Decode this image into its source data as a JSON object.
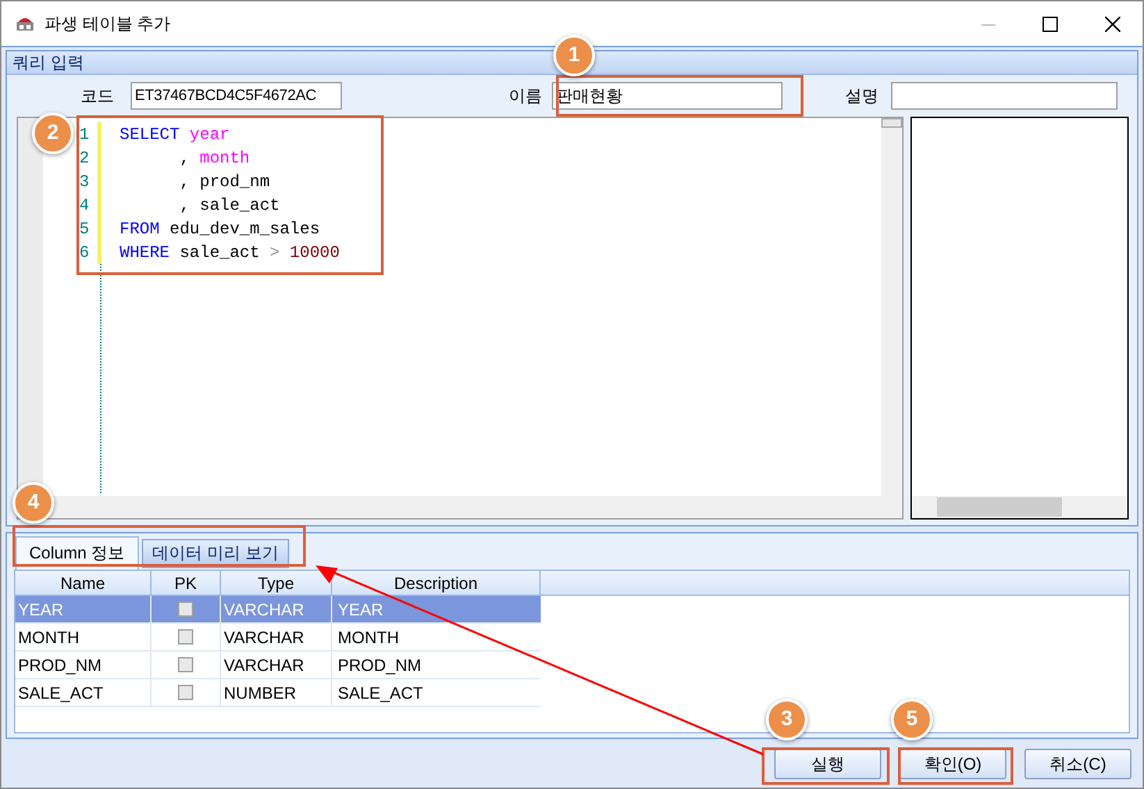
{
  "window": {
    "title": "파생 테이블 추가"
  },
  "group": {
    "title": "쿼리 입력"
  },
  "fields": [
    {
      "label": "코드",
      "value": "ET37467BCD4C5F4672AC"
    },
    {
      "label": "이름",
      "value": "판매현황"
    },
    {
      "label": "설명"
    }
  ],
  "editor": {
    "lines": [
      {
        "number": "1",
        "tokens": [
          {
            "kind": "keyword",
            "text": "SELECT"
          },
          {
            "kind": "column",
            "text": "year"
          }
        ]
      },
      {
        "number": "2",
        "tokens": [
          {
            "kind": "plain",
            "text": "      ,"
          },
          {
            "kind": "column",
            "text": "month"
          }
        ]
      },
      {
        "number": "3",
        "tokens": [
          {
            "kind": "plain",
            "text": "      ,"
          },
          {
            "kind": "plain",
            "text": "prod_nm"
          }
        ]
      },
      {
        "number": "4",
        "tokens": [
          {
            "kind": "plain",
            "text": "      ,"
          },
          {
            "kind": "plain",
            "text": "sale_act"
          }
        ]
      },
      {
        "number": "5",
        "tokens": [
          {
            "kind": "keyword",
            "text": "FROM"
          },
          {
            "kind": "plain",
            "text": "edu_dev_m_sales"
          }
        ]
      },
      {
        "number": "6",
        "tokens": [
          {
            "kind": "keyword",
            "text": "WHERE"
          },
          {
            "kind": "plain",
            "text": "sale_act"
          },
          {
            "kind": "operator",
            "text": ">"
          },
          {
            "kind": "number",
            "text": "10000"
          }
        ]
      }
    ]
  },
  "tabs": [
    {
      "label": "Column 정보",
      "selected": true
    },
    {
      "label": "데이터 미리 보기",
      "selected": false
    }
  ],
  "table": {
    "columns": [
      "Name",
      "PK",
      "Type",
      "Description"
    ],
    "rows": [
      {
        "name": "YEAR",
        "pk": false,
        "type": "VARCHAR",
        "description": "YEAR",
        "selected": true
      },
      {
        "name": "MONTH",
        "pk": false,
        "type": "VARCHAR",
        "description": "MONTH",
        "selected": false
      },
      {
        "name": "PROD_NM",
        "pk": false,
        "type": "VARCHAR",
        "description": "PROD_NM",
        "selected": false
      },
      {
        "name": "SALE_ACT",
        "pk": false,
        "type": "NUMBER",
        "description": "SALE_ACT",
        "selected": false
      }
    ]
  },
  "buttons": [
    "실행",
    "확인(O)",
    "취소(C)"
  ],
  "callouts": [
    {
      "label": "1"
    },
    {
      "label": "2"
    },
    {
      "label": "3"
    },
    {
      "label": "4"
    },
    {
      "label": "5"
    }
  ]
}
